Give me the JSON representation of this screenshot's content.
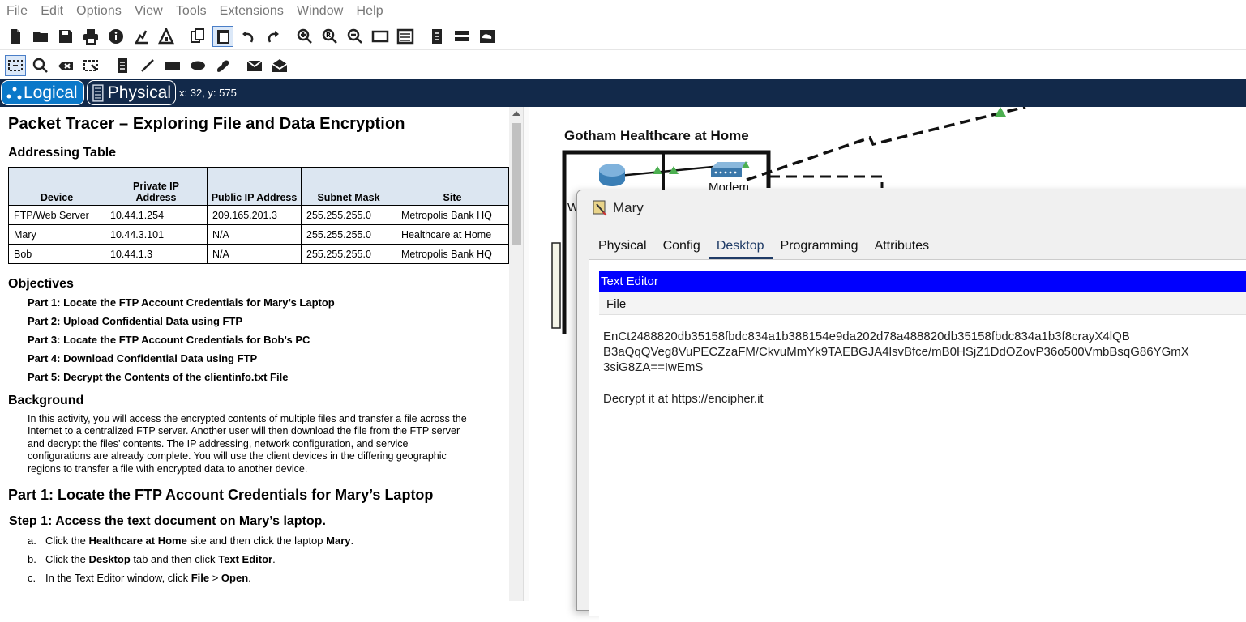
{
  "menubar": {
    "items": [
      "File",
      "Edit",
      "Options",
      "View",
      "Tools",
      "Extensions",
      "Window",
      "Help"
    ]
  },
  "toolbar_main": {
    "icons": [
      "new-file-icon",
      "open-folder-icon",
      "save-icon",
      "print-icon",
      "info-icon",
      "activity-wizard-icon",
      "pt-activity-icon",
      "copy-icon",
      "paste-icon",
      "undo-icon",
      "redo-icon",
      "zoom-in-icon",
      "zoom-reset-icon",
      "zoom-out-icon",
      "drawing-palette-icon",
      "custom-device-icon",
      "viewport-icon",
      "network-info-icon",
      "cluster-icon"
    ]
  },
  "toolbar_tools": {
    "icons": [
      "select-icon",
      "inspect-icon",
      "delete-icon",
      "resize-icon",
      "note-icon",
      "line-icon",
      "rectangle-icon",
      "ellipse-icon",
      "freeform-icon",
      "simple-pdu-icon",
      "complex-pdu-icon"
    ]
  },
  "modebar": {
    "logical_label": "Logical",
    "physical_label": "Physical",
    "coords": "x: 32, y: 575"
  },
  "doc": {
    "title": "Packet Tracer – Exploring File and Data Encryption",
    "addressing_heading": "Addressing Table",
    "table": {
      "headers": [
        "Device",
        "Private IP Address",
        "Public IP Address",
        "Subnet Mask",
        "Site"
      ],
      "rows": [
        [
          "FTP/Web Server",
          "10.44.1.254",
          "209.165.201.3",
          "255.255.255.0",
          "Metropolis Bank HQ"
        ],
        [
          "Mary",
          "10.44.3.101",
          "N/A",
          "255.255.255.0",
          "Healthcare at Home"
        ],
        [
          "Bob",
          "10.44.1.3",
          "N/A",
          "255.255.255.0",
          "Metropolis Bank HQ"
        ]
      ]
    },
    "objectives_heading": "Objectives",
    "objectives": [
      "Part 1: Locate the FTP Account Credentials for Mary’s Laptop",
      "Part 2: Upload Confidential Data using FTP",
      "Part 3: Locate the FTP Account Credentials for Bob’s PC",
      "Part 4: Download Confidential Data using FTP",
      "Part 5: Decrypt the Contents of the clientinfo.txt File"
    ],
    "background_heading": "Background",
    "background_lines": [
      "In this activity, you will access the encrypted contents of multiple files and transfer a file across the",
      "Internet to a centralized FTP server. Another user will then download the file from the FTP server",
      "and decrypt the files’ contents. The IP addressing, network configuration, and service",
      "configurations are already complete. You will use the client devices in the differing geographic",
      "regions to transfer a file with encrypted data to another device."
    ],
    "part1_heading": "Part 1: Locate the FTP Account Credentials for Mary’s Laptop",
    "step1_heading": "Step 1: Access the text document on Mary’s laptop.",
    "steps": [
      {
        "letter": "a.",
        "pre": "Click the ",
        "b1": "Healthcare at Home",
        "mid": " site and then click the laptop ",
        "b2": "Mary",
        "post": "."
      },
      {
        "letter": "b.",
        "pre": "Click the ",
        "b1": "Desktop",
        "mid": " tab and then click ",
        "b2": "Text Editor",
        "post": "."
      },
      {
        "letter": "c.",
        "pre": "In the Text Editor window, click ",
        "b1": "File",
        "mid": " > ",
        "b2": "Open",
        "post": "."
      }
    ]
  },
  "workspace": {
    "site_label": "Gotham Healthcare at Home",
    "modem_label": "Modem",
    "router_partial_label": "W"
  },
  "dialog": {
    "title": "Mary",
    "tabs": [
      "Physical",
      "Config",
      "Desktop",
      "Programming",
      "Attributes"
    ],
    "active_tab": "Desktop",
    "app_title": "Text Editor",
    "app_menu": "File",
    "content_lines": [
      "EnCt2488820db35158fbdc834a1b388154e9da202d78a488820db35158fbdc834a1b3f8crayX4lQB",
      "B3aQqQVeg8VuPECZzaFM/CkvuMmYk9TAEBGJA4lsvBfce/mB0HSjZ1DdOZovP36o500VmbBsqG86YGmX",
      "3siG8ZA==IwEmS",
      "",
      "Decrypt it at https://encipher.it"
    ]
  },
  "colors": {
    "modebar_bg": "#12294a",
    "logical_active": "#0a78c9",
    "text_editor_title": "#0000ff",
    "link_green": "#4caf50"
  }
}
